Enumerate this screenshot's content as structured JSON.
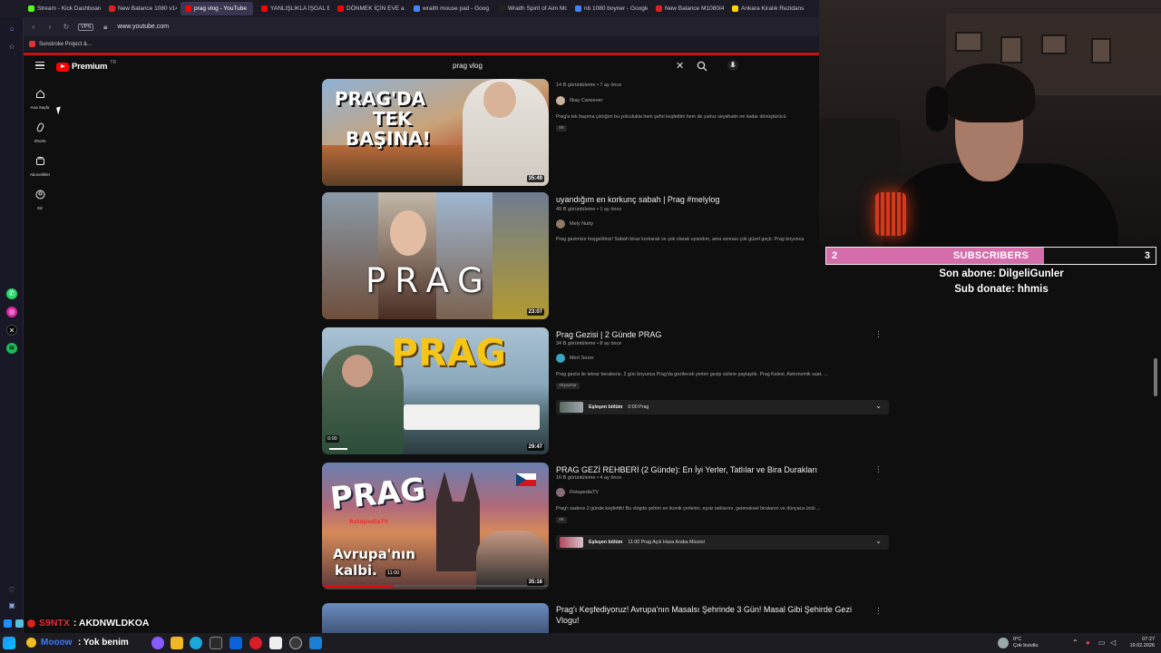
{
  "browser": {
    "tabs": [
      {
        "label": "Stream - Kick Dashboard",
        "color": "#53fc18"
      },
      {
        "label": "New Balance 1080 v14",
        "color": "#e02020"
      },
      {
        "label": "prag vlog - YouTube",
        "color": "#ff0000"
      },
      {
        "label": "YANLIŞLIKLA İŞGAL EDİLE",
        "color": "#ff0000"
      },
      {
        "label": "DÖNMEK İÇİN EVE a film",
        "color": "#ff0000"
      },
      {
        "label": "wraith mouse pad - Goog",
        "color": "#4285f4"
      },
      {
        "label": "Wraith Spirit of Aim Mous",
        "color": "#222222"
      },
      {
        "label": "nb 1080 boyner - Google",
        "color": "#4285f4"
      },
      {
        "label": "New Balance M1080I4 -",
        "color": "#e02020"
      },
      {
        "label": "Ankara Kiralık Rezidans F",
        "color": "#ffd400"
      }
    ],
    "active_tab": 2,
    "vpn_label": "VPN",
    "url": "www.youtube.com",
    "bookmark": "Sunstroke Project &...",
    "nav_icons": [
      "back-icon",
      "forward-icon",
      "reload-icon",
      "lock-icon"
    ]
  },
  "youtube": {
    "logo_word": "Premium",
    "logo_region": "TR",
    "search_query": "prag vlog",
    "guide": [
      {
        "label": "Ana Sayfa",
        "icon": "home-icon"
      },
      {
        "label": "Shorts",
        "icon": "shorts-icon"
      },
      {
        "label": "Abonelikler",
        "icon": "subscriptions-icon"
      },
      {
        "label": "Siz",
        "icon": "you-icon"
      }
    ],
    "videos": [
      {
        "title": "",
        "meta": "14 B görüntüleme • 7 ay önce",
        "channel": "İlkay Cansever",
        "desc": "Prag'a tek başıma çıktığım bu yolculukta hem şehri keşfettim hem de yalnız seyahatin ne kadar dönüştürücü",
        "badge": "4K",
        "duration": "35:49",
        "thumb_text": [
          "PRAG'DA",
          "TEK",
          "BAŞINA!"
        ],
        "has_menu": false
      },
      {
        "title": "uyandığım en korkunç sabah | Prag #melylog",
        "meta": "49 B görüntüleme • 1 ay önce",
        "channel": "Mely Nutty",
        "desc": "Prag gezimize hoşgeldiniz! Sabah biraz korkarak ve şok olarak uyandım, ama sonrası çok güzel geçti. Prag boyunca",
        "duration": "23:07",
        "thumb_text": [
          "PRAG"
        ],
        "has_menu": false
      },
      {
        "title": "Prag Gezisi | 2 Günde PRAG",
        "meta": "34 B görüntüleme • 8 ay önce",
        "channel": "Mert Sezer",
        "desc": "Prag gezisi ile tekrar beraberiz. 2 gün boyunca Prag'da gezilecek yerleri gezip sizlere paylaştık. Prag Kalesi, Astronomik saat, ...",
        "badge": "Altyazılar",
        "duration": "29:47",
        "progress_time": "0:00",
        "moment_label": "Eşleşen bölüm",
        "moment_text": "0:00 Prag",
        "thumb_text": [
          "PRAG"
        ],
        "has_menu": true
      },
      {
        "title": "PRAG GEZİ REHBERİ (2 Günde): En İyi Yerler, Tatlılar ve Bira Durakları",
        "meta": "16 B görüntüleme • 4 ay önce",
        "channel": "RotapediaTV",
        "desc": "Prag'ı sadece 2 günde keşfettik! Bu vlogda şehrin en ikonik yerlerini, eşsiz tatlılarını, geleneksel biralarını ve dünyaca ünlü ...",
        "badge": "4K",
        "duration": "35:16",
        "progress_time": "11:00",
        "moment_label": "Eşleşen bölüm",
        "moment_text": "11:00 Prag Açık Hava Araba Müzesi",
        "thumb_text": [
          "PRAG",
          "Avrupa'nın",
          "kalbi.",
          "RotapediaTV"
        ],
        "has_menu": true
      },
      {
        "title": "Prag'ı Keşfediyoruz! Avrupa'nın Masalsı Şehrinde 3 Gün! Masal Gibi Şehirde Gezi Vlogu!",
        "meta": "",
        "channel": "",
        "has_menu": true
      }
    ]
  },
  "stream_overlay": {
    "sub_count_left": "2",
    "sub_label": "SUBSCRIBERS",
    "sub_count_right": "3",
    "sub_progress": 0.66,
    "last_sub": "Son abone: DilgeliGunler",
    "sub_donate": "Sub donate: hhmis",
    "chat_user": "S9NTX",
    "chat_msg": ": AKDNWLDKOA",
    "ticker_user": "Mooow",
    "ticker_msg": ": Yok benim"
  },
  "taskbar": {
    "weather_temp": "0°C",
    "weather_desc": "Çok bulutlu",
    "time": "07:27",
    "date": "19.02.2026"
  },
  "colors": {
    "accent": "#ff0000",
    "sub_bar": "#d66dab"
  }
}
